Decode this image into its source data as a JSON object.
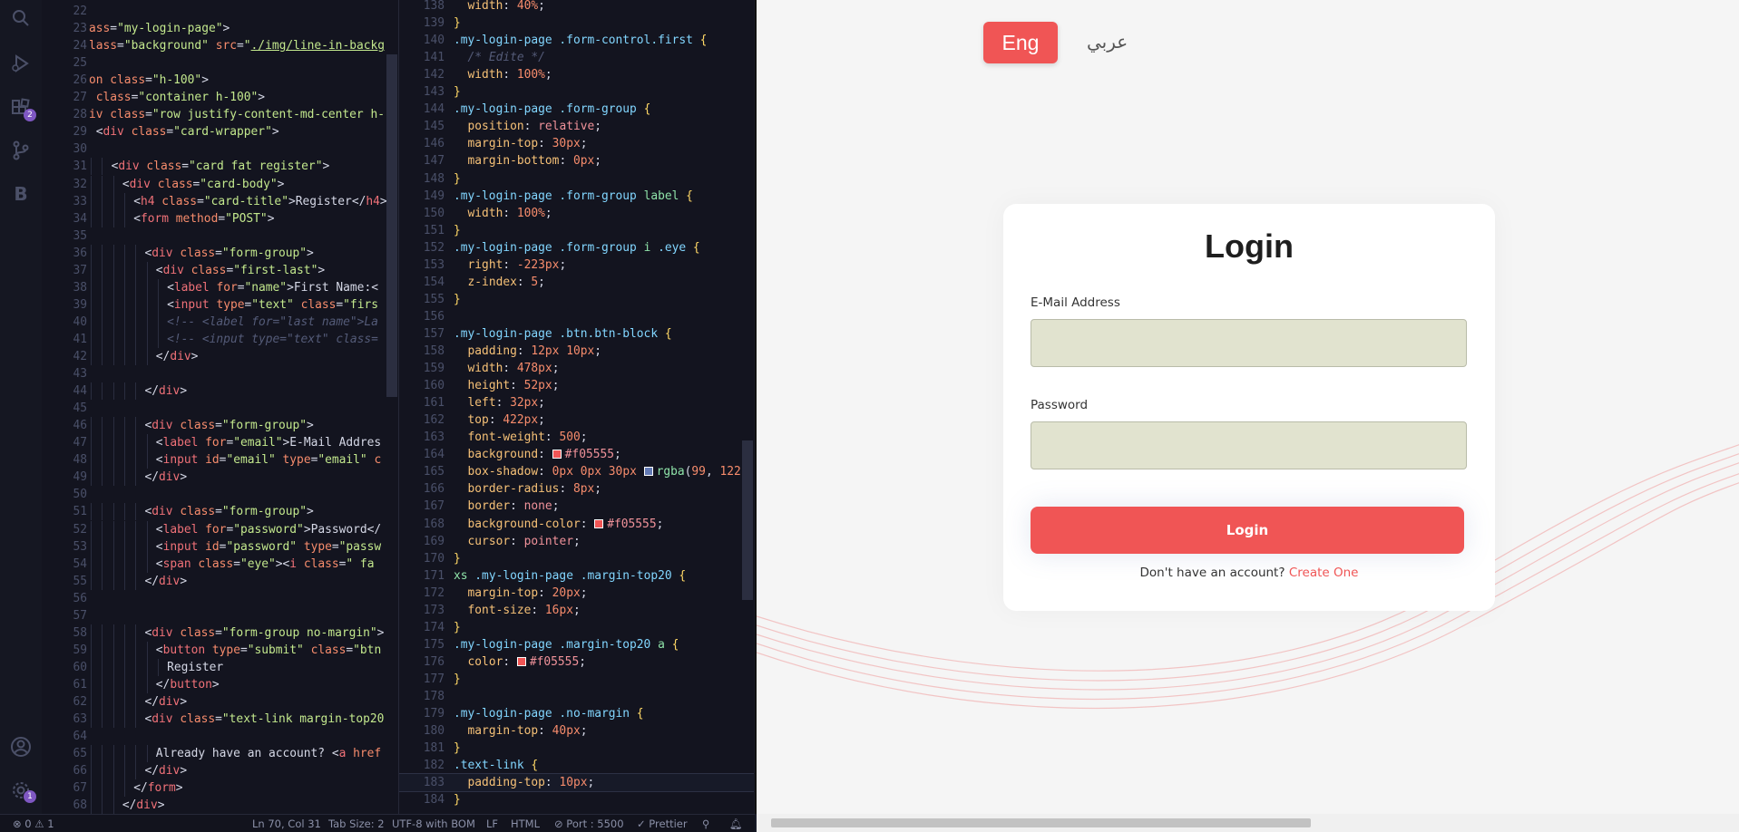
{
  "activity_bar": {
    "extensions_badge": "2",
    "settings_badge": "1",
    "extra_letter": "B"
  },
  "html_lines": [
    {
      "n": "22",
      "indent": 0,
      "html": ""
    },
    {
      "n": "23",
      "indent": 0,
      "html": "<span class='k'>ass</span>=<span class='s'>\"my-login-page\"</span>&gt;"
    },
    {
      "n": "24",
      "indent": 0,
      "html": "<span class='k'>lass</span>=<span class='s'>\"background\"</span> <span class='k'>src</span>=<span class='s'>\"<u>./img/line-in-backg</u></span>"
    },
    {
      "n": "25",
      "indent": 0,
      "html": ""
    },
    {
      "n": "26",
      "indent": 0,
      "html": "<span class='k'>on class</span>=<span class='s'>\"h-100\"</span>&gt;"
    },
    {
      "n": "27",
      "indent": 0,
      "html": " <span class='k'>class</span>=<span class='s'>\"container h-100\"</span>&gt;"
    },
    {
      "n": "28",
      "indent": 0,
      "html": "<span class='k'>iv class</span>=<span class='s'>\"row justify-content-md-center h-</span>"
    },
    {
      "n": "29",
      "indent": 0,
      "html": " &lt;<span class='tag'>div</span> <span class='k'>class</span>=<span class='s'>\"card-wrapper\"</span>&gt;"
    },
    {
      "n": "30",
      "indent": 0,
      "html": ""
    },
    {
      "n": "31",
      "indent": 2,
      "html": "&lt;<span class='tag'>div</span> <span class='k'>class</span>=<span class='s'>\"card fat register\"</span>&gt;"
    },
    {
      "n": "32",
      "indent": 3,
      "html": "&lt;<span class='tag'>div</span> <span class='k'>class</span>=<span class='s'>\"card-body\"</span>&gt;"
    },
    {
      "n": "33",
      "indent": 4,
      "html": "&lt;<span class='tag'>h4</span> <span class='k'>class</span>=<span class='s'>\"card-title\"</span>&gt;Register&lt;/<span class='tag'>h4</span>&gt;"
    },
    {
      "n": "34",
      "indent": 4,
      "html": "&lt;<span class='tag'>form</span> <span class='k'>method</span>=<span class='s'>\"POST\"</span>&gt;"
    },
    {
      "n": "35",
      "indent": 0,
      "html": ""
    },
    {
      "n": "36",
      "indent": 5,
      "html": "&lt;<span class='tag'>div</span> <span class='k'>class</span>=<span class='s'>\"form-group\"</span>&gt;"
    },
    {
      "n": "37",
      "indent": 6,
      "html": "&lt;<span class='tag'>div</span> <span class='k'>class</span>=<span class='s'>\"first-last\"</span>&gt;"
    },
    {
      "n": "38",
      "indent": 7,
      "html": "&lt;<span class='tag'>label</span> <span class='k'>for</span>=<span class='s'>\"name\"</span>&gt;First Name:&lt;"
    },
    {
      "n": "39",
      "indent": 7,
      "html": "&lt;<span class='tag'>input</span> <span class='k'>type</span>=<span class='s'>\"text\"</span> <span class='k'>class</span>=<span class='s'>\"firs</span>"
    },
    {
      "n": "40",
      "indent": 7,
      "html": "<span class='cm'>&lt;!-- &lt;label for=\"last name\"&gt;La</span>"
    },
    {
      "n": "41",
      "indent": 7,
      "html": "<span class='cm'>&lt;!-- &lt;input type=\"text\" class=</span>"
    },
    {
      "n": "42",
      "indent": 6,
      "html": "&lt;/<span class='tag'>div</span>&gt;"
    },
    {
      "n": "43",
      "indent": 0,
      "html": ""
    },
    {
      "n": "44",
      "indent": 5,
      "html": "&lt;/<span class='tag'>div</span>&gt;"
    },
    {
      "n": "45",
      "indent": 0,
      "html": ""
    },
    {
      "n": "46",
      "indent": 5,
      "html": "&lt;<span class='tag'>div</span> <span class='k'>class</span>=<span class='s'>\"form-group\"</span>&gt;"
    },
    {
      "n": "47",
      "indent": 6,
      "html": "&lt;<span class='tag'>label</span> <span class='k'>for</span>=<span class='s'>\"email\"</span>&gt;E-Mail Addres"
    },
    {
      "n": "48",
      "indent": 6,
      "html": "&lt;<span class='tag'>input</span> <span class='k'>id</span>=<span class='s'>\"email\"</span> <span class='k'>type</span>=<span class='s'>\"email\"</span> <span class='k'>c</span>"
    },
    {
      "n": "49",
      "indent": 5,
      "html": "&lt;/<span class='tag'>div</span>&gt;"
    },
    {
      "n": "50",
      "indent": 0,
      "html": ""
    },
    {
      "n": "51",
      "indent": 5,
      "html": "&lt;<span class='tag'>div</span> <span class='k'>class</span>=<span class='s'>\"form-group\"</span>&gt;"
    },
    {
      "n": "52",
      "indent": 6,
      "html": "&lt;<span class='tag'>label</span> <span class='k'>for</span>=<span class='s'>\"password\"</span>&gt;Password&lt;/"
    },
    {
      "n": "53",
      "indent": 6,
      "html": "&lt;<span class='tag'>input</span> <span class='k'>id</span>=<span class='s'>\"password\"</span> <span class='k'>type</span>=<span class='s'>\"passw</span>"
    },
    {
      "n": "54",
      "indent": 6,
      "html": "&lt;<span class='tag'>span</span> <span class='k'>class</span>=<span class='s'>\"eye\"</span>&gt;&lt;<span class='tag'>i</span> <span class='k'>class</span>=<span class='s'>\" fa</span>"
    },
    {
      "n": "55",
      "indent": 5,
      "html": "&lt;/<span class='tag'>div</span>&gt;"
    },
    {
      "n": "56",
      "indent": 0,
      "html": ""
    },
    {
      "n": "57",
      "indent": 0,
      "html": ""
    },
    {
      "n": "58",
      "indent": 5,
      "html": "&lt;<span class='tag'>div</span> <span class='k'>class</span>=<span class='s'>\"form-group no-margin\"</span>&gt;"
    },
    {
      "n": "59",
      "indent": 6,
      "html": "&lt;<span class='tag'>button</span> <span class='k'>type</span>=<span class='s'>\"submit\"</span> <span class='k'>class</span>=<span class='s'>\"btn</span>"
    },
    {
      "n": "60",
      "indent": 7,
      "html": "Register"
    },
    {
      "n": "61",
      "indent": 6,
      "html": "&lt;/<span class='tag'>button</span>&gt;"
    },
    {
      "n": "62",
      "indent": 5,
      "html": "&lt;/<span class='tag'>div</span>&gt;"
    },
    {
      "n": "63",
      "indent": 5,
      "html": "&lt;<span class='tag'>div</span> <span class='k'>class</span>=<span class='s'>\"text-link margin-top20</span>"
    },
    {
      "n": "64",
      "indent": 0,
      "html": ""
    },
    {
      "n": "65",
      "indent": 6,
      "html": "Already have an account? &lt;<span class='tag'>a</span> <span class='k'>href</span>"
    },
    {
      "n": "66",
      "indent": 5,
      "html": "&lt;/<span class='tag'>div</span>&gt;"
    },
    {
      "n": "67",
      "indent": 4,
      "html": "&lt;/<span class='tag'>form</span>&gt;"
    },
    {
      "n": "68",
      "indent": 3,
      "html": "&lt;/<span class='tag'>div</span>&gt;"
    }
  ],
  "css_lines": [
    {
      "n": "138",
      "html": "  <span class='prop'>width</span>: <span class='num'>40%</span>;"
    },
    {
      "n": "139",
      "html": "<span class='br'>}</span>"
    },
    {
      "n": "140",
      "html": "<span class='sel'>.my-login-page</span> <span class='sel'>.form-control.first</span> <span class='br'>{</span>"
    },
    {
      "n": "141",
      "html": "  <span class='cm'>/* Edite */</span>"
    },
    {
      "n": "142",
      "html": "  <span class='prop'>width</span>: <span class='num'>100%</span>;"
    },
    {
      "n": "143",
      "html": "<span class='br'>}</span>"
    },
    {
      "n": "144",
      "html": "<span class='sel'>.my-login-page</span> <span class='sel'>.form-group</span> <span class='br'>{</span>"
    },
    {
      "n": "145",
      "html": "  <span class='prop'>position</span>: <span class='val'>relative</span>;"
    },
    {
      "n": "146",
      "html": "  <span class='prop'>margin-top</span>: <span class='num'>30px</span>;"
    },
    {
      "n": "147",
      "html": "  <span class='prop'>margin-bottom</span>: <span class='num'>0px</span>;"
    },
    {
      "n": "148",
      "html": "<span class='br'>}</span>"
    },
    {
      "n": "149",
      "html": "<span class='sel'>.my-login-page</span> <span class='sel'>.form-group</span> <span class='selc'>label</span> <span class='br'>{</span>"
    },
    {
      "n": "150",
      "html": "  <span class='prop'>width</span>: <span class='num'>100%</span>;"
    },
    {
      "n": "151",
      "html": "<span class='br'>}</span>"
    },
    {
      "n": "152",
      "html": "<span class='sel'>.my-login-page</span> <span class='sel'>.form-group</span> <span class='selc'>i</span> <span class='sel'>.eye</span> <span class='br'>{</span>"
    },
    {
      "n": "153",
      "html": "  <span class='prop'>right</span>: <span class='num'>-223px</span>;"
    },
    {
      "n": "154",
      "html": "  <span class='prop'>z-index</span>: <span class='num'>5</span>;"
    },
    {
      "n": "155",
      "html": "<span class='br'>}</span>"
    },
    {
      "n": "156",
      "html": ""
    },
    {
      "n": "157",
      "html": "<span class='sel'>.my-login-page</span> <span class='sel'>.btn.btn-block</span> <span class='br'>{</span>"
    },
    {
      "n": "158",
      "html": "  <span class='prop'>padding</span>: <span class='num'>12px</span> <span class='num'>10px</span>;"
    },
    {
      "n": "159",
      "html": "  <span class='prop'>width</span>: <span class='num'>478px</span>;"
    },
    {
      "n": "160",
      "html": "  <span class='prop'>height</span>: <span class='num'>52px</span>;"
    },
    {
      "n": "161",
      "html": "  <span class='prop'>left</span>: <span class='num'>32px</span>;"
    },
    {
      "n": "162",
      "html": "  <span class='prop'>top</span>: <span class='num'>422px</span>;"
    },
    {
      "n": "163",
      "html": "  <span class='prop'>font-weight</span>: <span class='num'>500</span>;"
    },
    {
      "n": "164",
      "html": "  <span class='prop'>background</span>: <span class='sw' style='background:#f05555'></span><span class='val'>#f05555</span>;"
    },
    {
      "n": "165",
      "html": "  <span class='prop'>box-shadow</span>: <span class='num'>0px</span> <span class='num'>0px</span> <span class='num'>30px</span> <span class='sw' style='background:#637ab4'></span><span class='selc'>rgba</span>(<span class='num'>99</span>, <span class='num'>122</span>,"
    },
    {
      "n": "166",
      "html": "  <span class='prop'>border-radius</span>: <span class='num'>8px</span>;"
    },
    {
      "n": "167",
      "html": "  <span class='prop'>border</span>: <span class='val'>none</span>;"
    },
    {
      "n": "168",
      "html": "  <span class='prop'>background-color</span>: <span class='sw' style='background:#f05555'></span><span class='val'>#f05555</span>;"
    },
    {
      "n": "169",
      "html": "  <span class='prop'>cursor</span>: <span class='val'>pointer</span>;"
    },
    {
      "n": "170",
      "html": "<span class='br'>}</span>"
    },
    {
      "n": "171",
      "html": "<span class='selc'>xs</span> <span class='sel'>.my-login-page</span> <span class='sel'>.margin-top20</span> <span class='br'>{</span>"
    },
    {
      "n": "172",
      "html": "  <span class='prop'>margin-top</span>: <span class='num'>20px</span>;"
    },
    {
      "n": "173",
      "html": "  <span class='prop'>font-size</span>: <span class='num'>16px</span>;"
    },
    {
      "n": "174",
      "html": "<span class='br'>}</span>"
    },
    {
      "n": "175",
      "html": "<span class='sel'>.my-login-page</span> <span class='sel'>.margin-top20</span> <span class='selc'>a</span> <span class='br'>{</span>"
    },
    {
      "n": "176",
      "html": "  <span class='prop'>color</span>: <span class='sw' style='background:#f05555'></span><span class='val'>#f05555</span>;"
    },
    {
      "n": "177",
      "html": "<span class='br'>}</span>"
    },
    {
      "n": "178",
      "html": ""
    },
    {
      "n": "179",
      "html": "<span class='sel'>.my-login-page</span> <span class='sel'>.no-margin</span> <span class='br'>{</span>"
    },
    {
      "n": "180",
      "html": "  <span class='prop'>margin-top</span>: <span class='num'>40px</span>;"
    },
    {
      "n": "181",
      "html": "<span class='br'>}</span>"
    },
    {
      "n": "182",
      "html": "<span class='sel'>.text-link</span> <span class='br'>{</span>"
    },
    {
      "n": "183",
      "html": "  <span class='prop'>padding-top</span>: <span class='num'>10px</span>;"
    },
    {
      "n": "184",
      "html": "<span class='br'>}</span>"
    }
  ],
  "preview": {
    "lang_eng": "Eng",
    "lang_ar": "عربي",
    "title": "Login",
    "email_label": "E-Mail Address",
    "password_label": "Password",
    "login_button": "Login",
    "signup_text": "Don't have an account?",
    "signup_link": "Create One"
  },
  "status_bar": {
    "errors": "0",
    "warnings": "1",
    "cursor": "Ln 70, Col 31",
    "tab_size": "Tab Size: 2",
    "encoding": "UTF-8 with BOM",
    "eol": "LF",
    "language": "HTML",
    "port": "Port : 5500",
    "formatter": "Prettier"
  },
  "colors": {
    "accent": "#f05555",
    "input_bg": "#e1e3cf",
    "editor_bg": "#13141f"
  }
}
